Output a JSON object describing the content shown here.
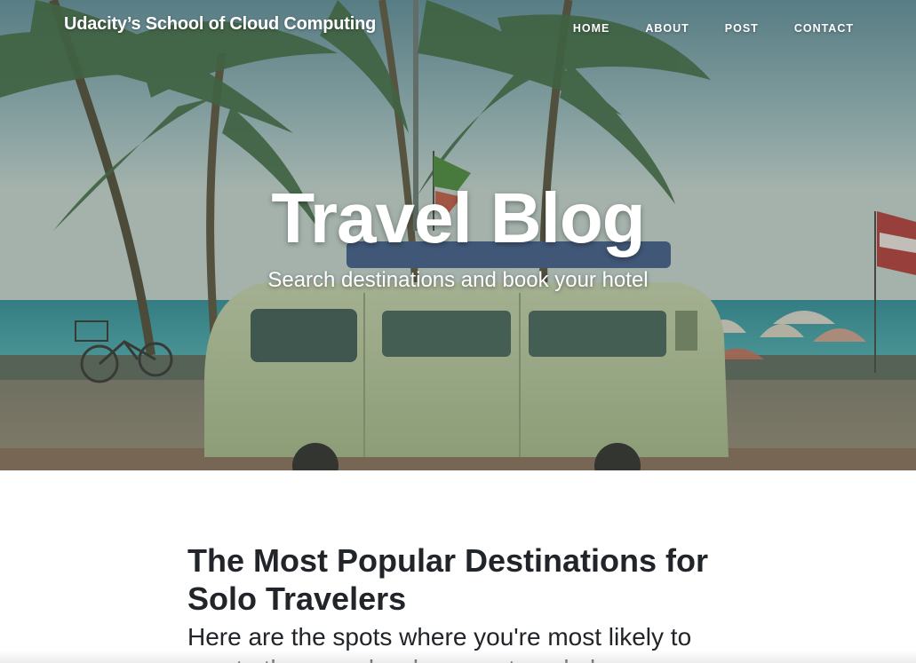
{
  "navbar": {
    "brand": "Udacity’s School of Cloud Computing",
    "links": [
      "HOME",
      "ABOUT",
      "POST",
      "CONTACT"
    ]
  },
  "hero": {
    "title": "Travel Blog",
    "subtitle": "Search destinations and book your hotel"
  },
  "post": {
    "title": "The Most Popular Destinations for Solo Travelers",
    "subtitle": "Here are the spots where you're most likely to meet other people when you travel alone"
  },
  "colors": {
    "text_dark": "#212529",
    "nav_text": "#ffffff"
  }
}
